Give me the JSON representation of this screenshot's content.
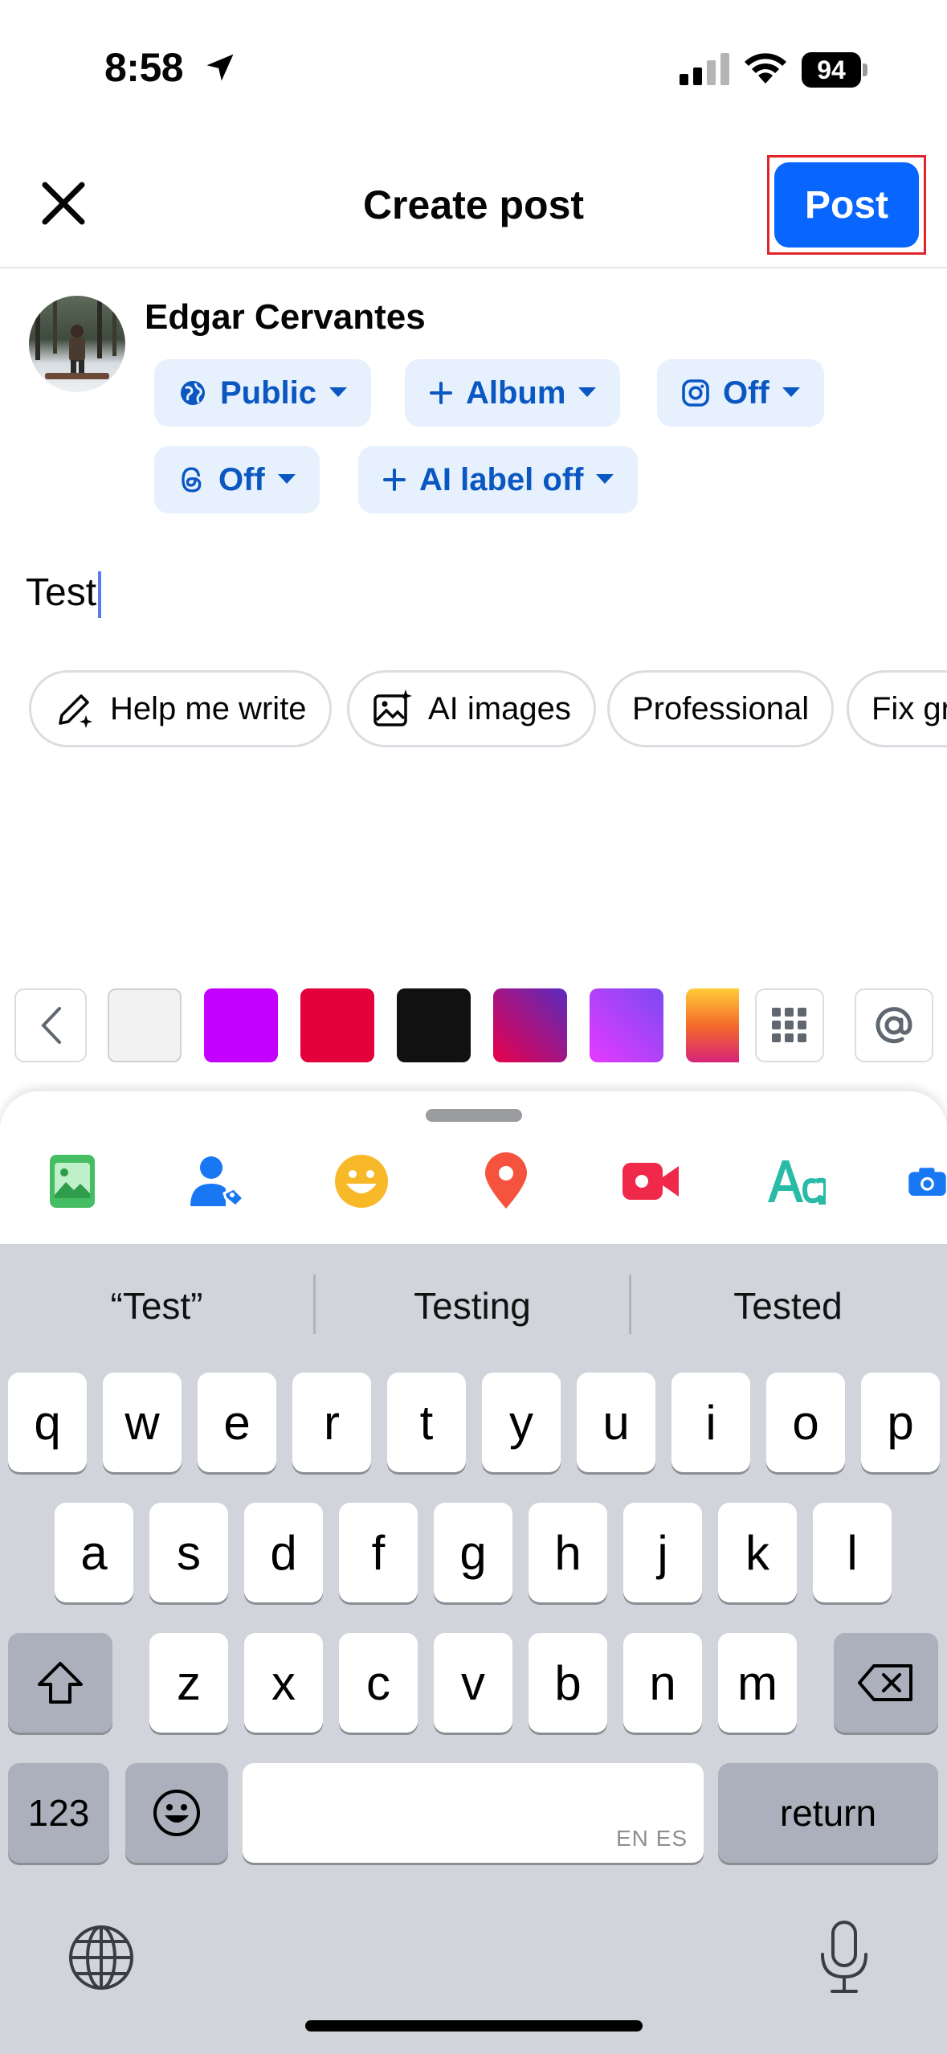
{
  "status_bar": {
    "time": "8:58",
    "battery": "94"
  },
  "header": {
    "title": "Create post",
    "post_label": "Post"
  },
  "user": {
    "name": "Edgar Cervantes"
  },
  "audience_chips": [
    {
      "label": "Public"
    },
    {
      "label": "Album"
    },
    {
      "label": "Off"
    },
    {
      "label": "Off"
    },
    {
      "label": "AI label off"
    }
  ],
  "composer": {
    "text": "Test"
  },
  "ai_chips": [
    {
      "label": "Help me write"
    },
    {
      "label": "AI images"
    },
    {
      "label": "Professional"
    },
    {
      "label": "Fix gr"
    }
  ],
  "background_colors": [
    "#f2f2f2",
    "#c400ff",
    "#e4003a",
    "#111111",
    "gradient-red-blue",
    "gradient-purple-pink",
    "gradient-yellow-orange"
  ],
  "toolbar_icons": [
    "photo-icon",
    "tag-people-icon",
    "feeling-icon",
    "check-in-icon",
    "live-video-icon",
    "text-style-icon",
    "camera-icon"
  ],
  "keyboard": {
    "suggestions": [
      "“Test”",
      "Testing",
      "Tested"
    ],
    "row1": [
      "q",
      "w",
      "e",
      "r",
      "t",
      "y",
      "u",
      "i",
      "o",
      "p"
    ],
    "row2": [
      "a",
      "s",
      "d",
      "f",
      "g",
      "h",
      "j",
      "k",
      "l"
    ],
    "row3": [
      "z",
      "x",
      "c",
      "v",
      "b",
      "n",
      "m"
    ],
    "numbers_label": "123",
    "space_hint": "EN ES",
    "return_label": "return"
  },
  "colors": {
    "accent": "#0866ff",
    "chip_bg": "#e7f0fd",
    "chip_text": "#0a57c2",
    "highlight_border": "#e0242a"
  }
}
